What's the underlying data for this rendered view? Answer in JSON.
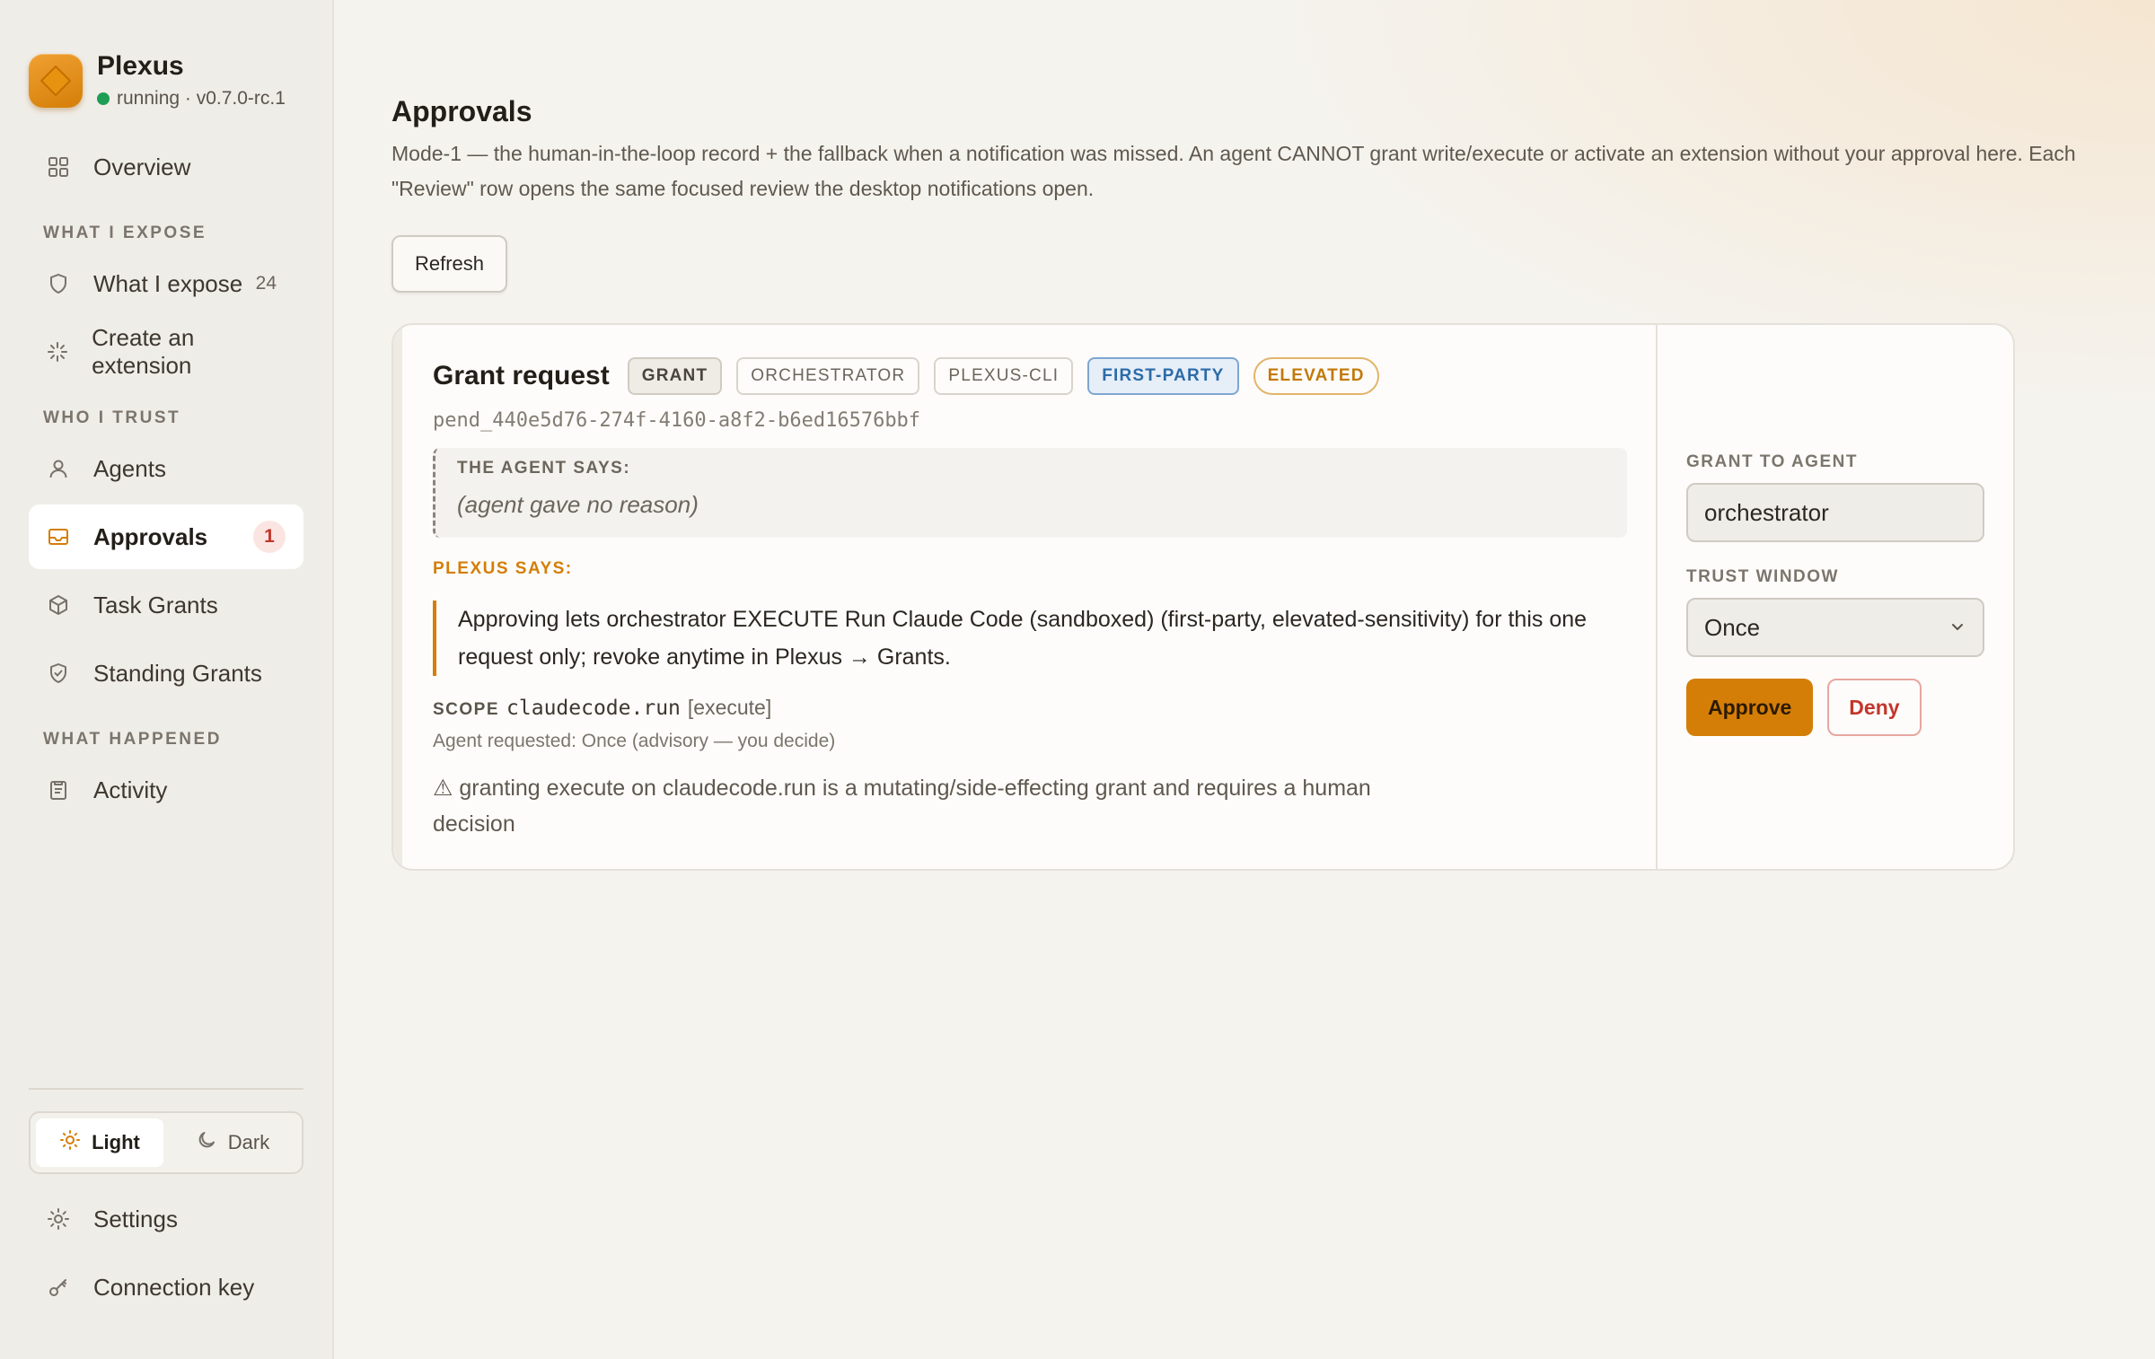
{
  "app": {
    "name": "Plexus",
    "status": "running · v0.7.0-rc.1",
    "status_color": "#1e9e55",
    "accent": "#d47e08"
  },
  "sidebar": {
    "overview": {
      "label": "Overview",
      "icon": "grid-icon"
    },
    "sections": [
      {
        "label": "WHAT I EXPOSE"
      },
      {
        "label": "WHO I TRUST"
      },
      {
        "label": "WHAT HAPPENED"
      }
    ],
    "items": [
      {
        "label": "What I expose",
        "count": "24",
        "icon": "shield-icon"
      },
      {
        "label": "Create an extension",
        "icon": "sparkle-icon"
      },
      {
        "label": "Agents",
        "icon": "user-icon"
      },
      {
        "label": "Approvals",
        "badge": "1",
        "icon": "inbox-icon",
        "active": true
      },
      {
        "label": "Task Grants",
        "icon": "box-icon"
      },
      {
        "label": "Standing Grants",
        "icon": "shield-check-icon"
      },
      {
        "label": "Activity",
        "icon": "clipboard-icon"
      }
    ],
    "theme": {
      "light": "Light",
      "dark": "Dark",
      "selected": "Light"
    },
    "bottom": [
      {
        "label": "Settings",
        "icon": "gear-icon"
      },
      {
        "label": "Connection key",
        "icon": "key-icon"
      }
    ]
  },
  "main": {
    "title": "Approvals",
    "description": "Mode-1 — the human-in-the-loop record + the fallback when a notification was missed. An agent CANNOT grant write/execute or activate an extension without your approval here. Each \"Review\" row opens the same focused review the desktop notifications open.",
    "refresh_label": "Refresh",
    "request": {
      "title": "Grant request",
      "tags": [
        "GRANT",
        "ORCHESTRATOR",
        "PLEXUS-CLI",
        "FIRST-PARTY",
        "ELEVATED"
      ],
      "id": "pend_440e5d76-274f-4160-a8f2-b6ed16576bbf",
      "agent_says_label": "THE AGENT SAYS:",
      "agent_reason": "(agent gave no reason)",
      "plexus_says_label": "PLEXUS SAYS:",
      "plexus_message": "Approving lets orchestrator EXECUTE Run Claude Code (sandboxed) (first-party, elevated-sensitivity) for this one request only; revoke anytime in Plexus → Grants.",
      "scope_label": "SCOPE",
      "scope_value": "claudecode.run",
      "scope_mode": "[execute]",
      "agent_requested": "Agent requested: Once (advisory — you decide)",
      "warning": "⚠ granting execute on claudecode.run is a mutating/side-effecting grant and requires a human decision"
    },
    "decision": {
      "grant_to_label": "GRANT TO AGENT",
      "grant_to_value": "orchestrator",
      "trust_window_label": "TRUST WINDOW",
      "trust_window_value": "Once",
      "approve_label": "Approve",
      "deny_label": "Deny"
    }
  }
}
